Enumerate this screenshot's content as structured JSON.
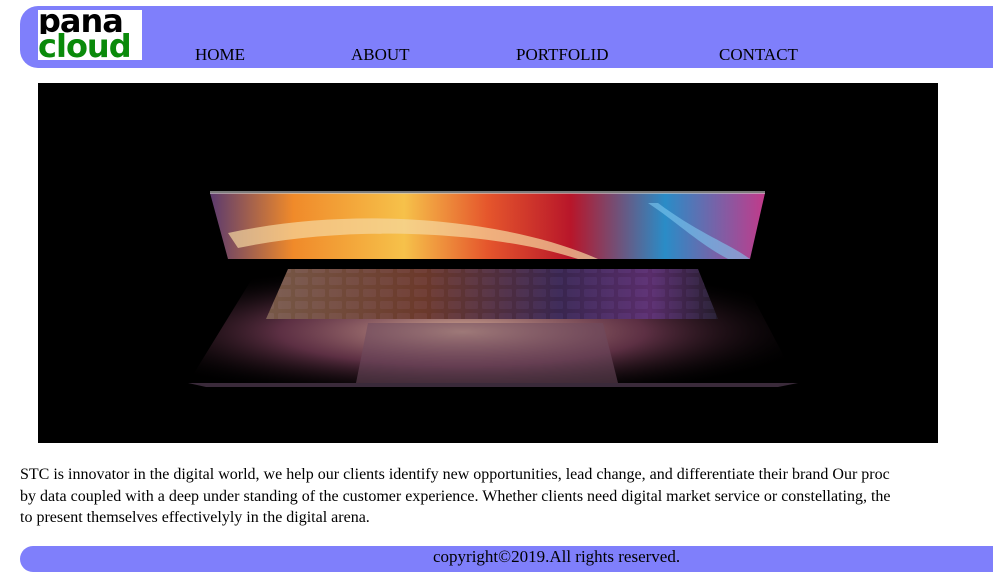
{
  "header": {
    "logo": {
      "line1": "pana",
      "line2": "cloud"
    },
    "nav": [
      {
        "label": "HOME"
      },
      {
        "label": "ABOUT"
      },
      {
        "label": "PORTFOLID"
      },
      {
        "label": "CONTACT"
      }
    ]
  },
  "hero": {
    "image": "laptop-photo"
  },
  "about": {
    "lines": [
      "STC is innovator in the digital world, we help our clients identify new opportunities, lead change, and differentiate their brand Our proc",
      "by data coupled with a deep under standing of the customer experience. Whether clients need digital market service or constellating, the",
      "to present themselves effectivelyly in the digital arena."
    ]
  },
  "footer": {
    "copyright": "copyright©2019.All rights reserved."
  },
  "colors": {
    "bar": "#7f7ffb",
    "logo_accent": "#0a8a0a",
    "hero_bg": "#000000"
  }
}
